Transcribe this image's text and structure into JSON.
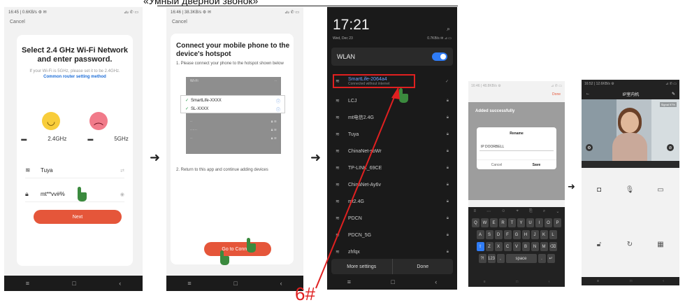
{
  "page_title": "«Умный дверной звонок»",
  "screen1": {
    "status_left": "16:45 | 0.6KB/s ⚙ ✉",
    "status_right": "⊿ᵢₗ ✆ ▭",
    "cancel": "Cancel",
    "title": "Select 2.4 GHz Wi-Fi Network and enter password.",
    "subtitle": "If your Wi-Fi is 5GHz, please set it to be 2.4GHz.",
    "link": "Common router setting method",
    "band_24": "2.4GHz",
    "band_5": "5GHz",
    "wifi_name": "Tuya",
    "wifi_right": "⇄",
    "password": "mt**vv#%",
    "next": "Next"
  },
  "screen2": {
    "status_left": "16:46 | 38.3KB/s ⚙ ✉",
    "status_right": "⊿ᵢₗ ✆ ▭",
    "cancel": "Cancel",
    "title": "Connect your mobile phone to the device's hotspot",
    "step1": "1. Please connect your phone to the hotspot shown below",
    "list_top": [
      "Wi-Fi",
      "··"
    ],
    "hotspots": [
      "SmartLife-XXXX",
      "SL-XXXX"
    ],
    "list_bottom": [
      "··",
      "······",
      "··"
    ],
    "step2": "2. Return to this app and continue adding devices",
    "go_btn": "Go to Connect"
  },
  "screen3": {
    "time": "17:21",
    "date": "Wed, Dec 23",
    "status_right": "0.7KB/s ✉ ⊿ ▭",
    "wlan": "WLAN",
    "selected_network": "SmartLife-2064a4",
    "selected_sub": "Connected without internet",
    "networks": [
      "LCJ",
      "mt电信2.4G",
      "Tuya",
      "ChinaNet-sbWr",
      "TP-LINK_69CE",
      "ChinaNet-Ay6v",
      "mt2.4G",
      "PDCN",
      "PDCN_5G",
      "zhfqx"
    ],
    "more_settings": "More settings",
    "done": "Done"
  },
  "screen4": {
    "status_left": "16:46 | 48.8KB/s ⚙",
    "status_right": "⊿ ✆ ▭",
    "done": "Done",
    "added": "Added successfully",
    "rename_title": "Rename",
    "rename_value": "IP DOORBELL",
    "cancel": "Cancel",
    "save": "Save",
    "kb_row1": [
      "Q",
      "W",
      "E",
      "R",
      "T",
      "Y",
      "U",
      "I",
      "O",
      "P"
    ],
    "kb_row2": [
      "A",
      "S",
      "D",
      "F",
      "G",
      "H",
      "J",
      "K",
      "L"
    ],
    "kb_row3": [
      "⇧",
      "Z",
      "X",
      "C",
      "V",
      "B",
      "N",
      "M",
      "⌫"
    ],
    "kb_row4": [
      "?!",
      "123",
      ",",
      "space",
      ".",
      "↵"
    ]
  },
  "screen5": {
    "status_left": "16:52 | 12.6KB/s ⚙",
    "status_right": "⊿ ✆ ▭",
    "title": "IP室内机",
    "signal": "Signal 97%"
  },
  "annotation": "6#",
  "colors": {
    "accent_orange": "#e5563a",
    "link_blue": "#1f6fd8",
    "toggle_blue": "#2f7cf6",
    "red": "#e02020",
    "hand_green": "#3b8a3e"
  }
}
